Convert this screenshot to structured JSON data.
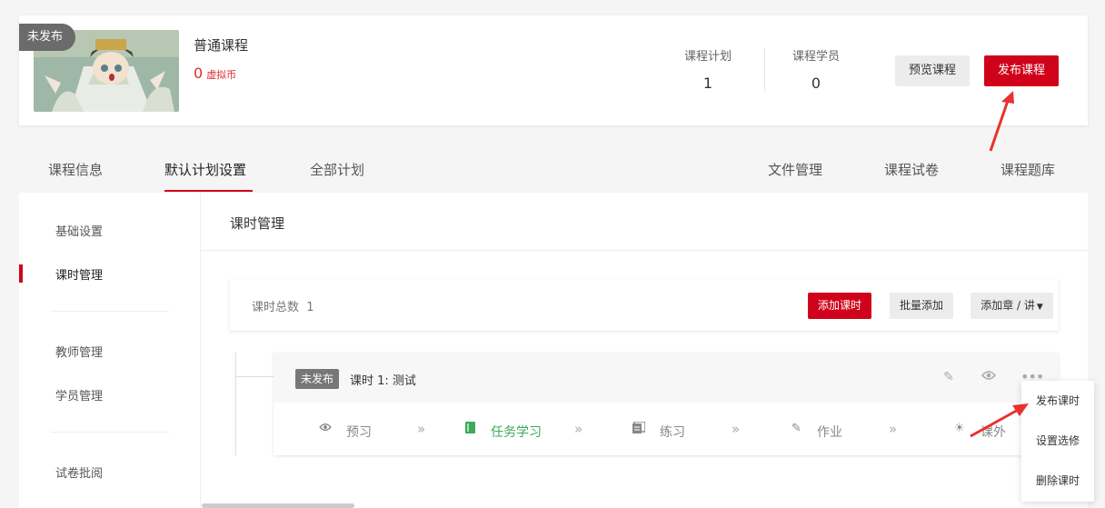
{
  "course": {
    "status_badge": "未发布",
    "title": "普通课程",
    "price_value": "0",
    "price_unit": "虚拟币",
    "stats": [
      {
        "label": "课程计划",
        "value": "1"
      },
      {
        "label": "课程学员",
        "value": "0"
      }
    ],
    "preview_label": "预览课程",
    "publish_label": "发布课程"
  },
  "tabs": {
    "left": [
      "课程信息",
      "默认计划设置",
      "全部计划"
    ],
    "right": [
      "文件管理",
      "课程试卷",
      "课程题库"
    ],
    "active": "默认计划设置"
  },
  "sidebar": {
    "items": [
      "基础设置",
      "课时管理",
      "教师管理",
      "学员管理",
      "试卷批阅"
    ],
    "active": "课时管理"
  },
  "section": {
    "title": "课时管理",
    "total_label": "课时总数",
    "total_value": "1",
    "add_lesson_label": "添加课时",
    "batch_add_label": "批量添加",
    "add_chapter_label": "添加章 / 讲"
  },
  "lesson": {
    "status": "未发布",
    "name": "课时 1:  测试",
    "icons": [
      "edit-icon",
      "eye-icon",
      "more-icon"
    ],
    "tasks": [
      {
        "icon": "eye-icon",
        "label": "预习"
      },
      {
        "icon": "book-icon",
        "label": "任务学习"
      },
      {
        "icon": "list-icon",
        "label": "练习"
      },
      {
        "icon": "pencil-icon",
        "label": "作业"
      },
      {
        "icon": "sun-icon",
        "label": "课外"
      }
    ]
  },
  "dropdown": {
    "items": [
      "发布课时",
      "设置选修",
      "删除课时"
    ]
  },
  "colors": {
    "accent": "#d0021b",
    "active_task": "#3aaa5a"
  }
}
